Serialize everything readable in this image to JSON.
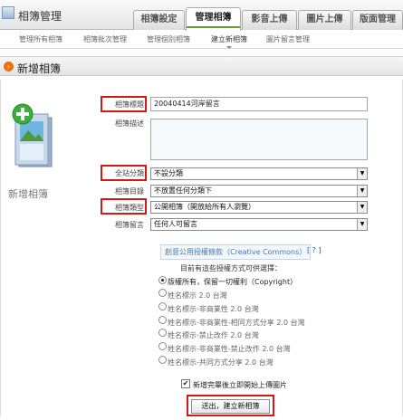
{
  "header": {
    "title": "相簿管理",
    "tabs": [
      "相簿設定",
      "管理相簿",
      "影音上傳",
      "圖片上傳",
      "版面管理"
    ],
    "active_tab": "管理相簿"
  },
  "subnav": {
    "items": [
      "管理所有相簿",
      "相簿批次管理",
      "管理個別相簿",
      "建立新相簿",
      "圖片留言管理"
    ],
    "active": "建立新相簿"
  },
  "section": {
    "title": "新增相簿",
    "icon": "arrow-right-icon"
  },
  "sidebar": {
    "label": "新增相簿",
    "icon": "album-add-icon"
  },
  "form": {
    "title_label": "相簿標題",
    "title_value": "20040414河岸留言",
    "desc_label": "相簿描述",
    "desc_value": "",
    "category_label": "全站分類",
    "category_value": "不設分類",
    "folder_label": "相簿目錄",
    "folder_value": "不放置任何分類下",
    "type_label": "相簿類型",
    "type_value": "公開相簿（開放給所有人瀏覽）",
    "comment_label": "相簿留言",
    "comment_value": "任何人可留言"
  },
  "license": {
    "link": "創意公用授權條款（Creative Commons）",
    "help": "[ ? ]",
    "heading": "目前有這些授權方式可供選擇：",
    "options": [
      "版權所有，保留一切權利（Copyright）",
      "姓名標示 2.0 台灣",
      "姓名標示-非商業性 2.0 台灣",
      "姓名標示-非商業性-相同方式分享 2.0 台灣",
      "姓名標示-禁止改作 2.0 台灣",
      "姓名標示-非商業性-禁止改作 2.0 台灣",
      "姓名標示-共同方式分享 2.0 台灣"
    ],
    "selected_index": 0
  },
  "checkbox": {
    "label": "新增完畢後立即開始上傳圖片",
    "checked": true
  },
  "submit": {
    "label": "送出，建立新相簿"
  },
  "colors": {
    "highlight": "#d01a1a",
    "accent_orange": "#e9711c",
    "tab_underline": "#6a9a33",
    "link": "#4a7ab0"
  }
}
